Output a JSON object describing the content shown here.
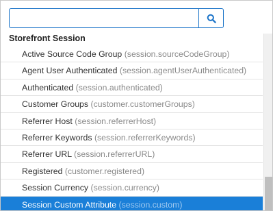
{
  "search": {
    "value": "",
    "placeholder": "",
    "button_icon": "search-icon"
  },
  "group": {
    "title": "Storefront Session"
  },
  "items": [
    {
      "name": "Active Source Code Group",
      "path": "(session.sourceCodeGroup)"
    },
    {
      "name": "Agent User Authenticated",
      "path": "(session.agentUserAuthenticated)"
    },
    {
      "name": "Authenticated",
      "path": "(session.authenticated)"
    },
    {
      "name": "Customer Groups",
      "path": "(customer.customerGroups)"
    },
    {
      "name": "Referrer Host",
      "path": "(session.referrerHost)"
    },
    {
      "name": "Referrer Keywords",
      "path": "(session.referrerKeywords)"
    },
    {
      "name": "Referrer URL",
      "path": "(session.referrerURL)"
    },
    {
      "name": "Registered",
      "path": "(customer.registered)"
    },
    {
      "name": "Session Currency",
      "path": "(session.currency)"
    },
    {
      "name": "Session Custom Attribute",
      "path": "(session.custom)"
    }
  ],
  "selected_item": "Session Custom Attribute",
  "colors": {
    "accent": "#1a73c8",
    "selected_bg": "#1a7fd8"
  }
}
